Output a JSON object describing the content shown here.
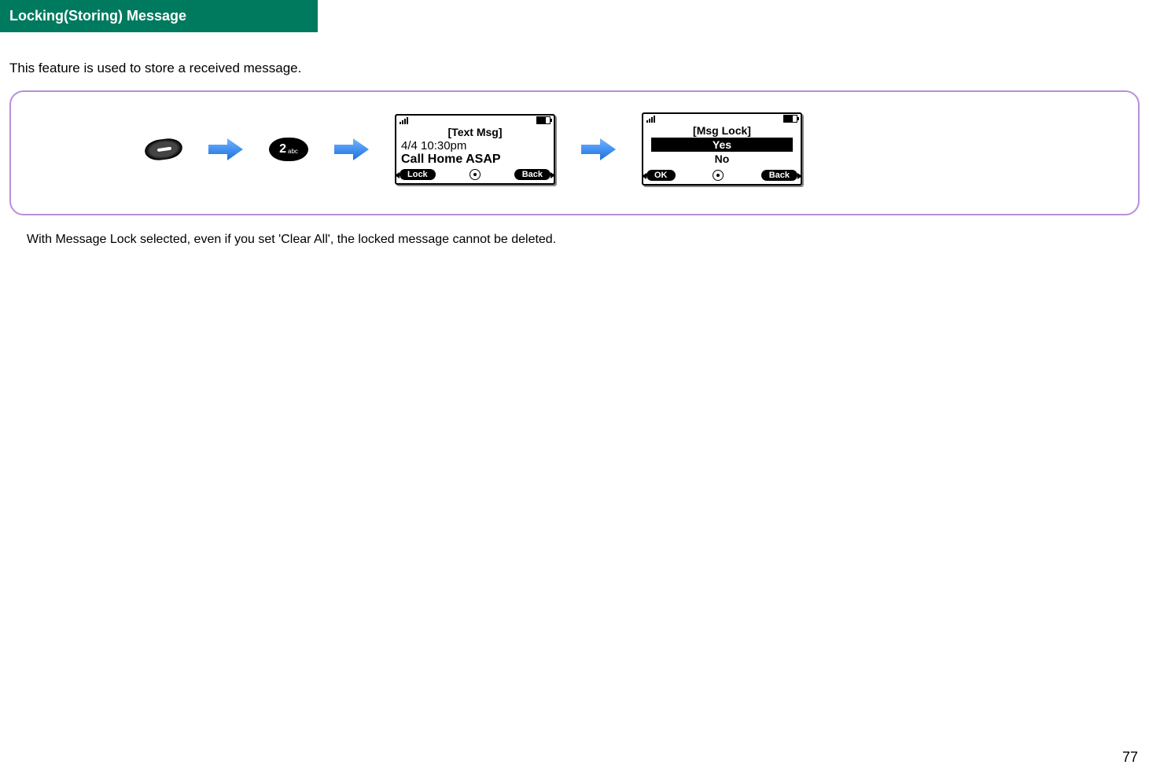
{
  "header": {
    "title": "Locking(Storing) Message"
  },
  "intro": "This feature is used to store a received message.",
  "steps": {
    "softkey_name": "left-softkey-icon",
    "numkey": {
      "digit": "2",
      "sub": "abc"
    }
  },
  "screen1": {
    "title": "[Text Msg]",
    "line1": "4/4 10:30pm",
    "line2": "Call Home ASAP",
    "left": "Lock",
    "right": "Back"
  },
  "screen2": {
    "title": "[Msg Lock]",
    "options": [
      "Yes",
      "No"
    ],
    "selected_index": 0,
    "left": "OK",
    "right": "Back"
  },
  "note": "With Message Lock selected, even if you set 'Clear All', the locked message cannot be deleted.",
  "page_number": "77"
}
